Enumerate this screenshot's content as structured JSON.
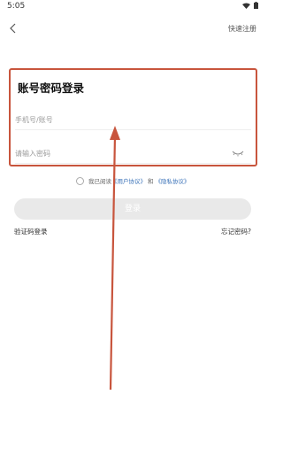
{
  "status_bar": {
    "time": "5:05"
  },
  "header": {
    "back_icon": "chevron-left-icon",
    "quick_register": "快速注册"
  },
  "form": {
    "title": "账号密码登录",
    "account_placeholder": "手机号/账号",
    "password_placeholder": "请输入密码",
    "eye_icon": "eye-closed-icon"
  },
  "agreement": {
    "prefix": "我已阅读",
    "user_agreement": "《用户协议》",
    "conjunction": "和",
    "privacy_policy": "《隐私协议》"
  },
  "login_button": "登录",
  "sms_login": "验证码登录",
  "forgot_password": "忘记密码?",
  "colors": {
    "highlight": "#c8553d",
    "link": "#3a72b8",
    "button_disabled": "#e9e9e9"
  }
}
